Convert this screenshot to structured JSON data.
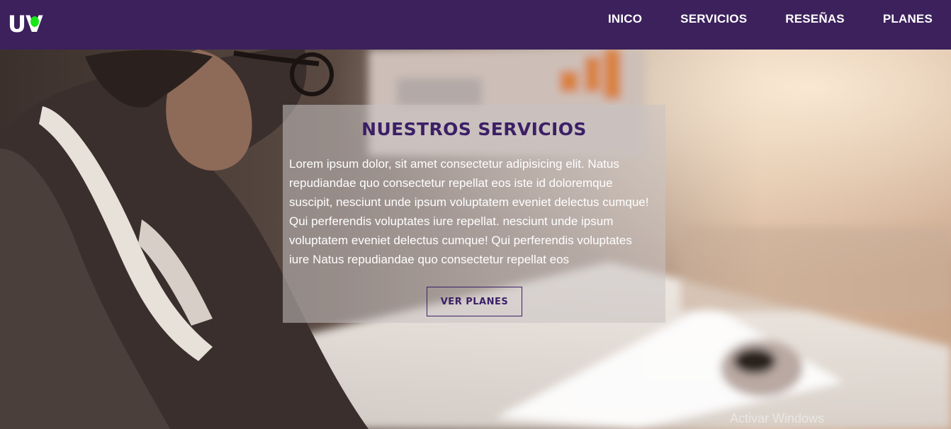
{
  "header": {
    "logo_text": "UV",
    "nav": [
      {
        "label": "INICO"
      },
      {
        "label": "SERVICIOS"
      },
      {
        "label": "RESEÑAS"
      },
      {
        "label": "PLANES"
      }
    ]
  },
  "hero": {
    "title": "NUESTROS SERVICIOS",
    "text": "Lorem ipsum dolor, sit amet consectetur adipisicing elit. Natus repudiandae quo consectetur repellat eos iste id doloremque suscipit, nesciunt unde ipsum voluptatem eveniet delectus cumque! Qui perferendis voluptates iure repellat. nesciunt unde ipsum voluptatem eveniet delectus cumque! Qui perferendis voluptates iure Natus repudiandae quo consectetur repellat eos",
    "button_label": "VER PLANES"
  },
  "watermark": "Activar Windows",
  "colors": {
    "header_bg": "#3c215c",
    "accent": "#3c1f66",
    "logo_dot": "#18e618"
  }
}
